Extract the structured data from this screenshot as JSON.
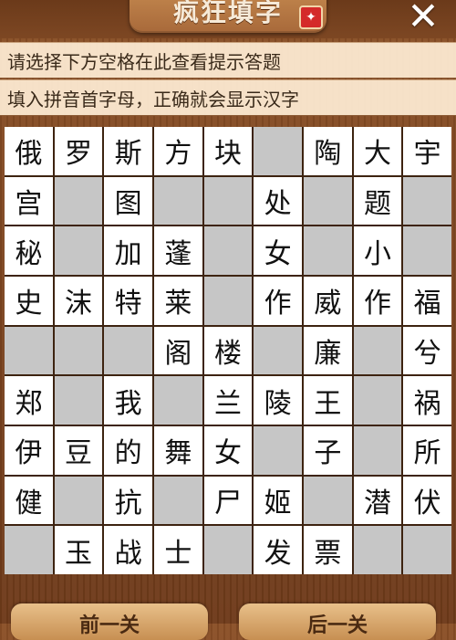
{
  "header": {
    "title": "疯狂填字",
    "badge_icon": "ribbon-icon",
    "close_icon": "close-icon"
  },
  "hints": [
    "请选择下方空格在此查看提示答题",
    "填入拼音首字母，正确就会显示汉字"
  ],
  "grid": {
    "rows": [
      [
        "俄",
        "罗",
        "斯",
        "方",
        "块",
        "",
        "陶",
        "大",
        "宇"
      ],
      [
        "宫",
        "",
        "图",
        "",
        "",
        "处",
        "",
        "题",
        ""
      ],
      [
        "秘",
        "",
        "加",
        "蓬",
        "",
        "女",
        "",
        "小",
        ""
      ],
      [
        "史",
        "沫",
        "特",
        "莱",
        "",
        "作",
        "威",
        "作",
        "福"
      ],
      [
        "",
        "",
        "",
        "阁",
        "楼",
        "",
        "廉",
        "",
        "兮"
      ],
      [
        "郑",
        "",
        "我",
        "",
        "兰",
        "陵",
        "王",
        "",
        "祸"
      ],
      [
        "伊",
        "豆",
        "的",
        "舞",
        "女",
        "",
        "子",
        "",
        "所"
      ],
      [
        "健",
        "",
        "抗",
        "",
        "尸",
        "姬",
        "",
        "潜",
        "伏"
      ],
      [
        "",
        "玉",
        "战",
        "士",
        "",
        "发",
        "票",
        "",
        ""
      ]
    ]
  },
  "footer": {
    "prev_label": "前一关",
    "next_label": "后一关"
  }
}
